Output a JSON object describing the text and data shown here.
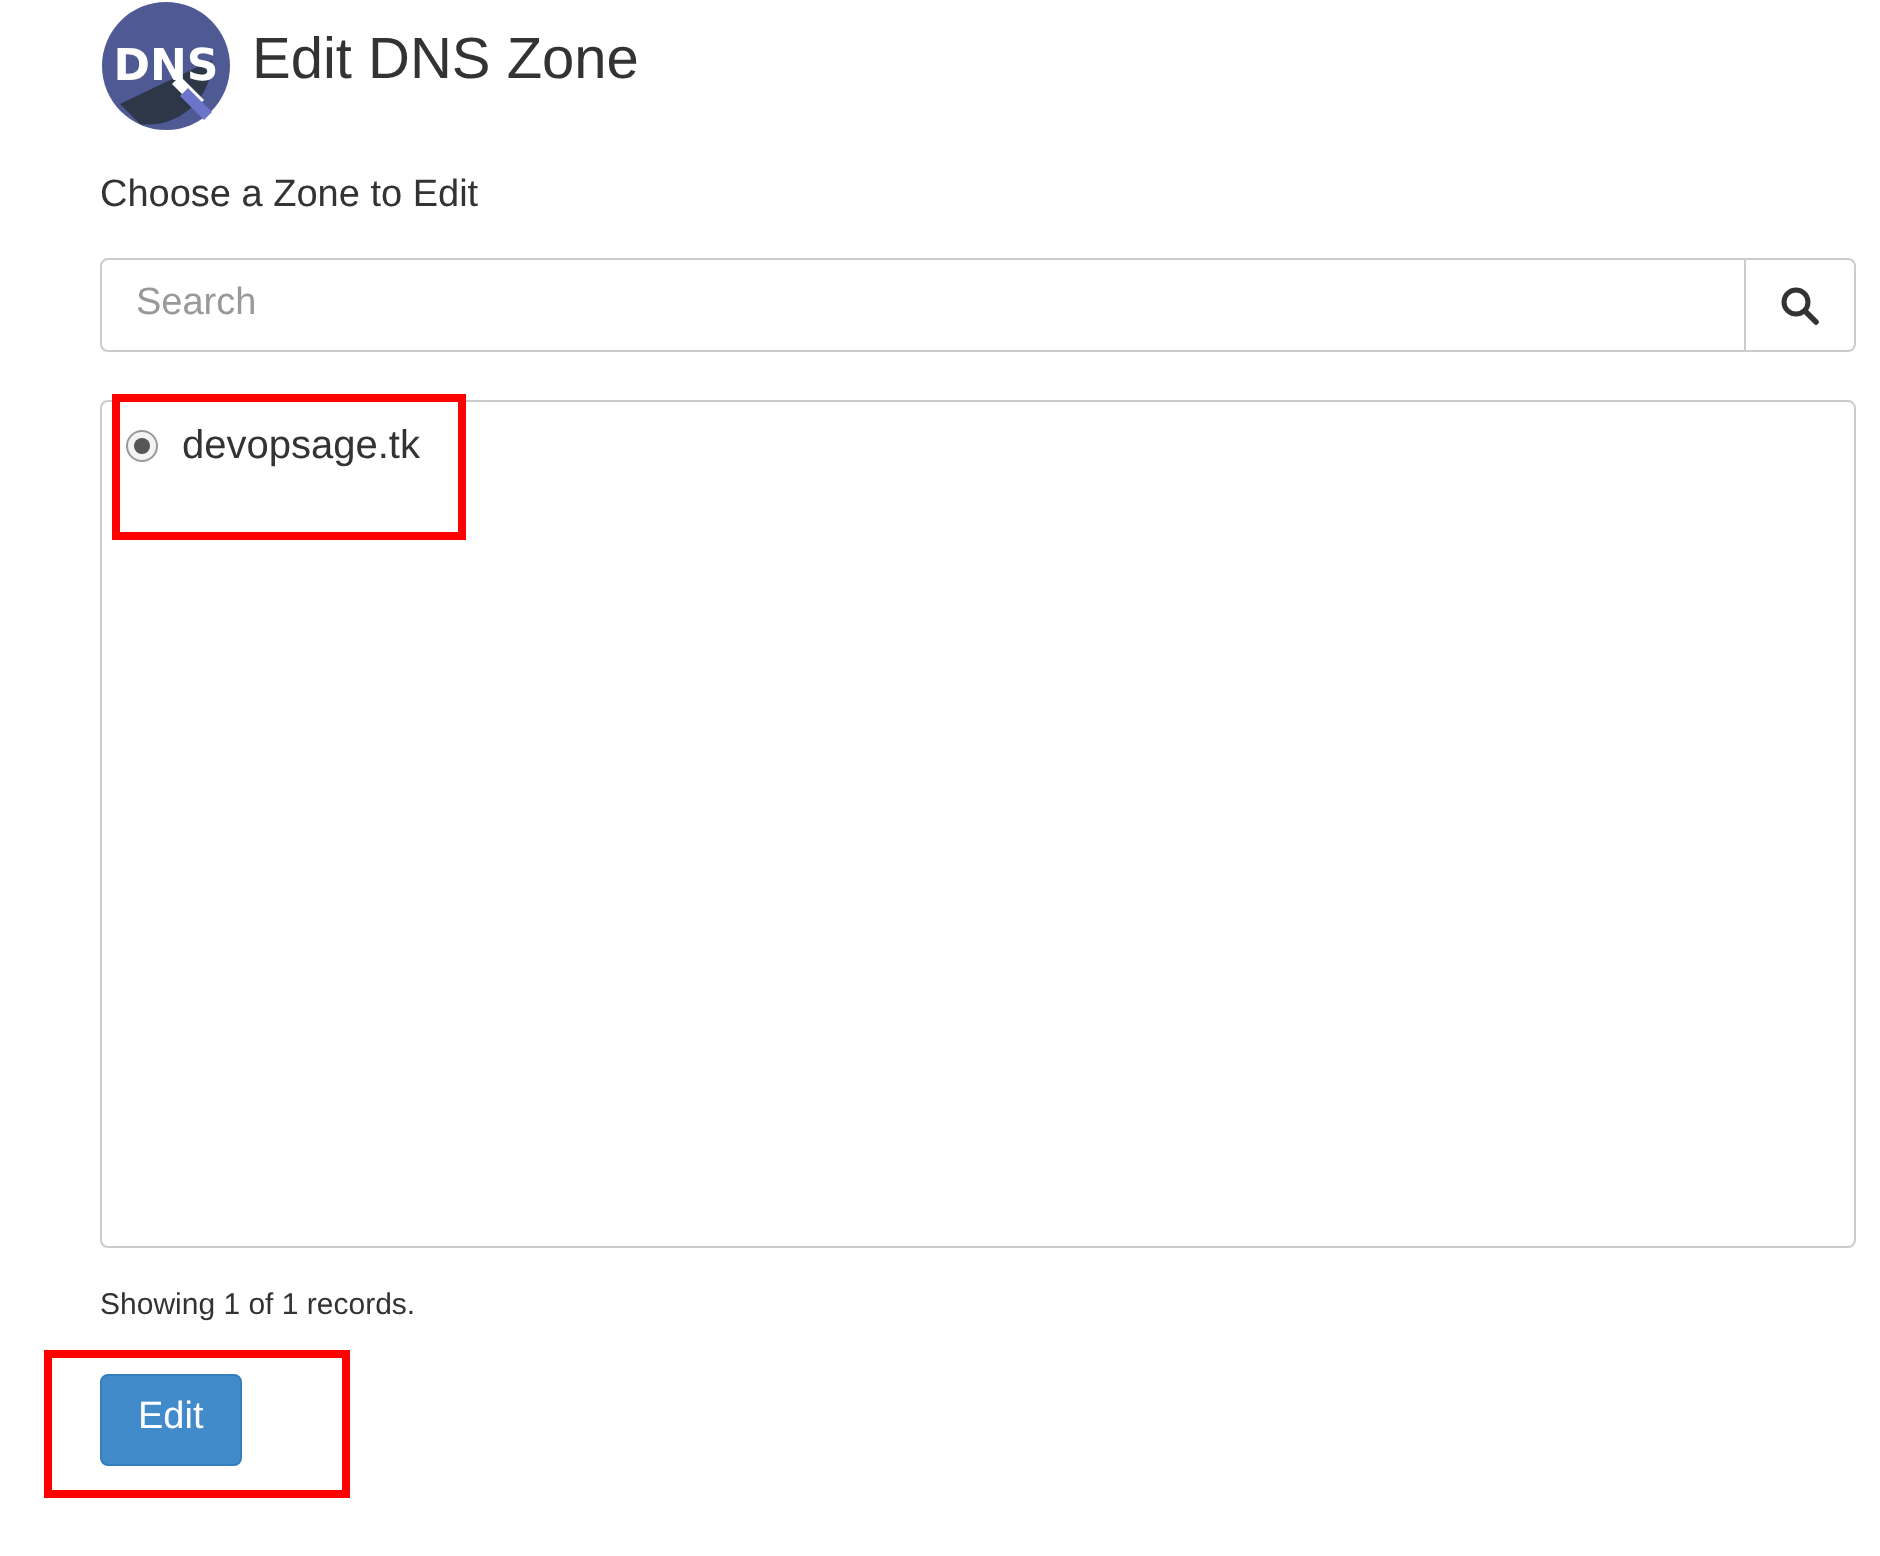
{
  "header": {
    "logo_text": "DNS",
    "title": "Edit DNS Zone"
  },
  "subtitle": "Choose a Zone to Edit",
  "search": {
    "placeholder": "Search"
  },
  "zones": [
    {
      "name": "devopsage.tk",
      "selected": true,
      "highlighted": true
    }
  ],
  "status": "Showing 1 of 1 records.",
  "edit_button": {
    "label": "Edit",
    "highlighted": true
  }
}
